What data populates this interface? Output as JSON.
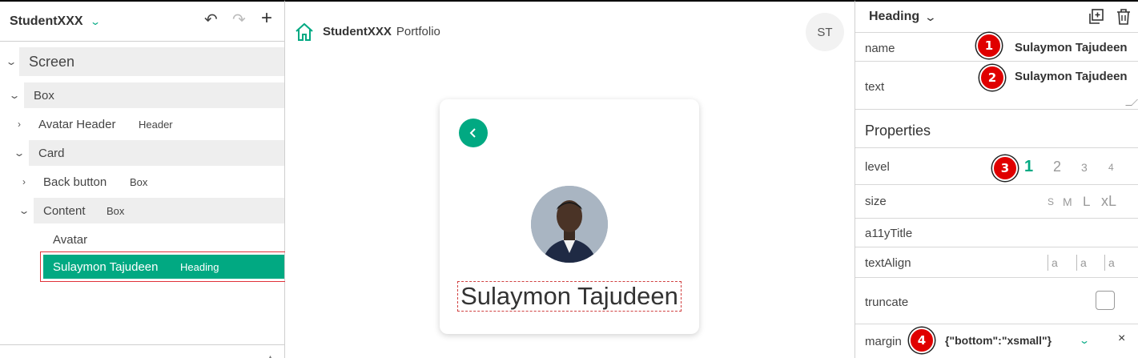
{
  "left_panel": {
    "app_name": "StudentXXX",
    "app_caret": "⌄",
    "undo_glyph": "↶",
    "redo_glyph": "↷",
    "add_glyph": "+",
    "tree": [
      {
        "label": "Screen",
        "type": "",
        "expanded": true
      },
      {
        "label": "Box",
        "type": "",
        "expanded": true
      },
      {
        "label": "Avatar Header",
        "type": "Header",
        "expanded": false
      },
      {
        "label": "Card",
        "type": "",
        "expanded": true
      },
      {
        "label": "Back button",
        "type": "Box",
        "expanded": false
      },
      {
        "label": "Content",
        "type": "Box",
        "expanded": true
      },
      {
        "label": "Avatar",
        "type": ""
      },
      {
        "label": "Sulaymon Tajudeen",
        "type": "Heading",
        "selected": true
      }
    ]
  },
  "canvas": {
    "brand_name": "StudentXXX",
    "brand_sub": "Portfolio",
    "user_initials": "ST",
    "card_heading": "Sulaymon Tajudeen"
  },
  "right_panel": {
    "component_type": "Heading",
    "name_label": "name",
    "name_value": "Sulaymon Tajudeen",
    "text_label": "text",
    "text_value": "Sulaymon Tajudeen",
    "properties_title": "Properties",
    "level_label": "level",
    "level_options": [
      "1",
      "2",
      "3",
      "4"
    ],
    "level_selected": "1",
    "size_label": "size",
    "size_options": [
      "S",
      "M",
      "L",
      "xL"
    ],
    "a11y_label": "a11yTitle",
    "text_align_label": "textAlign",
    "text_align_options": [
      "a",
      "a",
      "a"
    ],
    "truncate_label": "truncate",
    "margin_label": "margin",
    "margin_value": "{\"bottom\":\"xsmall\"}",
    "margin_clear": "×",
    "badges": [
      "1",
      "2",
      "3",
      "4"
    ]
  },
  "colors": {
    "accent": "#01a982",
    "selection_outline": "#e0333a",
    "badge": "#e00000"
  },
  "icons": [
    "undo-icon",
    "redo-icon",
    "add-icon",
    "home-icon",
    "back-chevron-icon",
    "duplicate-icon",
    "trash-icon",
    "chevron-down-icon",
    "chevron-right-icon"
  ]
}
